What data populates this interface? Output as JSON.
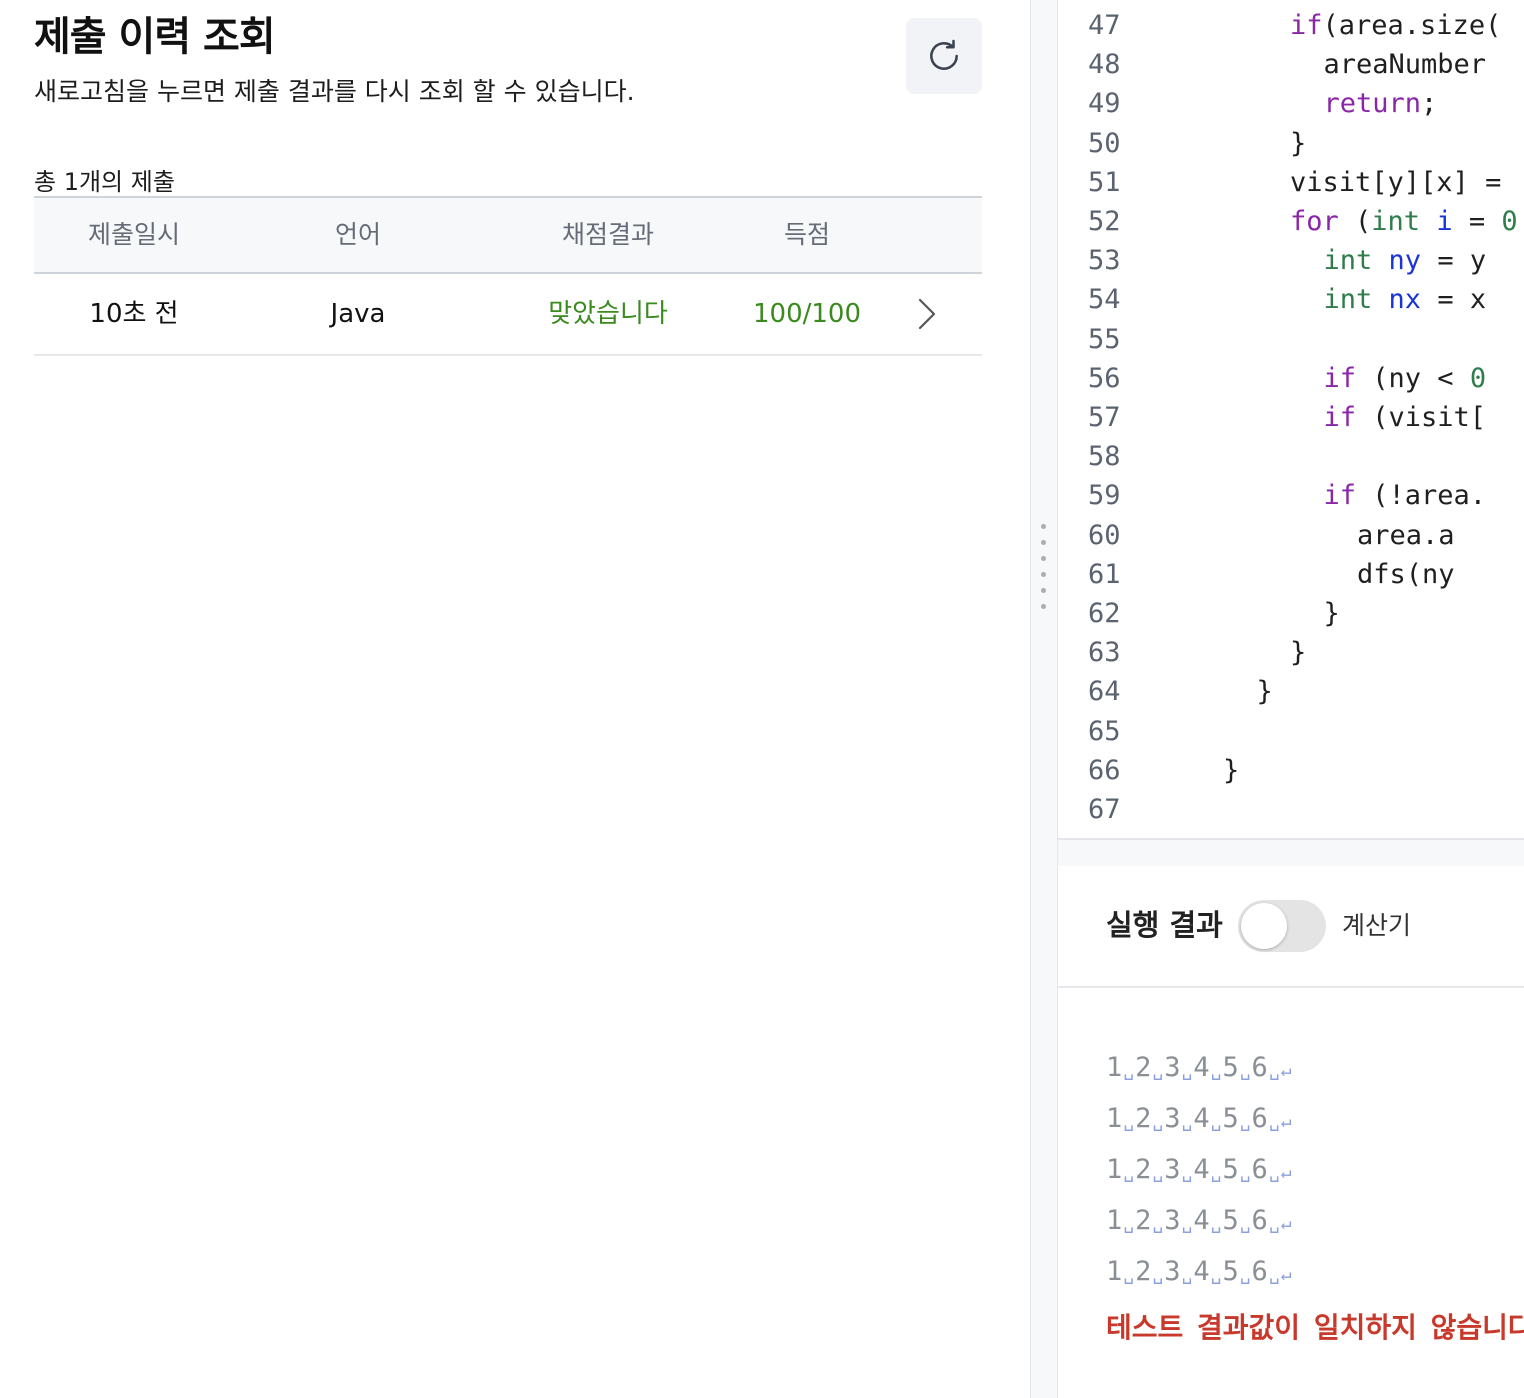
{
  "header": {
    "title": "제출 이력 조회",
    "subtitle": "새로고침을 누르면 제출 결과를 다시 조회 할 수 있습니다.",
    "refresh_icon": "refresh-icon"
  },
  "submissions": {
    "count_label": "총 1개의 제출",
    "columns": [
      "제출일시",
      "언어",
      "채점결과",
      "득점"
    ],
    "rows": [
      {
        "time": "10초 전",
        "language": "Java",
        "result": "맞았습니다",
        "score": "100/100"
      }
    ]
  },
  "colors": {
    "success": "#3a8a1e",
    "error": "#c8392b",
    "keyword": "#8a26a8",
    "type": "#2e7d4a",
    "variable": "#1a35d6"
  },
  "editor": {
    "lines": [
      {
        "n": "47",
        "indent": 4,
        "tokens": [
          [
            "kw",
            "if"
          ],
          [
            "",
            "(area.size("
          ]
        ]
      },
      {
        "n": "48",
        "indent": 5,
        "tokens": [
          [
            "",
            "areaNumber"
          ]
        ]
      },
      {
        "n": "49",
        "indent": 5,
        "tokens": [
          [
            "kw",
            "return"
          ],
          [
            "",
            ";"
          ]
        ]
      },
      {
        "n": "50",
        "indent": 4,
        "tokens": [
          [
            "",
            "}"
          ]
        ]
      },
      {
        "n": "51",
        "indent": 4,
        "tokens": [
          [
            "",
            "visit[y][x] ="
          ]
        ]
      },
      {
        "n": "52",
        "indent": 4,
        "tokens": [
          [
            "kw",
            "for"
          ],
          [
            "",
            " ("
          ],
          [
            "ty",
            "int"
          ],
          [
            "",
            " "
          ],
          [
            "var",
            "i"
          ],
          [
            "",
            " = "
          ],
          [
            "num",
            "0"
          ]
        ]
      },
      {
        "n": "53",
        "indent": 5,
        "tokens": [
          [
            "ty",
            "int"
          ],
          [
            "",
            " "
          ],
          [
            "var",
            "ny"
          ],
          [
            "",
            " = y"
          ]
        ]
      },
      {
        "n": "54",
        "indent": 5,
        "tokens": [
          [
            "ty",
            "int"
          ],
          [
            "",
            " "
          ],
          [
            "var",
            "nx"
          ],
          [
            "",
            " = x"
          ]
        ]
      },
      {
        "n": "55",
        "indent": 0,
        "tokens": []
      },
      {
        "n": "56",
        "indent": 5,
        "tokens": [
          [
            "kw",
            "if"
          ],
          [
            "",
            " (ny < "
          ],
          [
            "num",
            "0"
          ]
        ]
      },
      {
        "n": "57",
        "indent": 5,
        "tokens": [
          [
            "kw",
            "if"
          ],
          [
            "",
            " (visit["
          ]
        ]
      },
      {
        "n": "58",
        "indent": 0,
        "tokens": []
      },
      {
        "n": "59",
        "indent": 5,
        "tokens": [
          [
            "kw",
            "if"
          ],
          [
            "",
            " (!area."
          ]
        ]
      },
      {
        "n": "60",
        "indent": 6,
        "tokens": [
          [
            "",
            "area.a"
          ]
        ]
      },
      {
        "n": "61",
        "indent": 6,
        "tokens": [
          [
            "",
            "dfs(ny"
          ]
        ]
      },
      {
        "n": "62",
        "indent": 5,
        "tokens": [
          [
            "",
            "}"
          ]
        ]
      },
      {
        "n": "63",
        "indent": 4,
        "tokens": [
          [
            "",
            "}"
          ]
        ]
      },
      {
        "n": "64",
        "indent": 3,
        "tokens": [
          [
            "",
            "}"
          ]
        ]
      },
      {
        "n": "65",
        "indent": 0,
        "tokens": []
      },
      {
        "n": "66",
        "indent": 2,
        "tokens": [
          [
            "",
            "}"
          ]
        ]
      },
      {
        "n": "67",
        "indent": 0,
        "tokens": []
      }
    ]
  },
  "result": {
    "title": "실행 결과",
    "toggle_on": false,
    "calc_label": "계산기",
    "output_lines": [
      [
        "1",
        "2",
        "3",
        "4",
        "5",
        "6"
      ],
      [
        "1",
        "2",
        "3",
        "4",
        "5",
        "6"
      ],
      [
        "1",
        "2",
        "3",
        "4",
        "5",
        "6"
      ],
      [
        "1",
        "2",
        "3",
        "4",
        "5",
        "6"
      ],
      [
        "1",
        "2",
        "3",
        "4",
        "5",
        "6"
      ]
    ],
    "space_glyph": "␣",
    "newline_glyph": "↵",
    "error_message": "테스트 결과값이 일치하지 않습니다"
  }
}
